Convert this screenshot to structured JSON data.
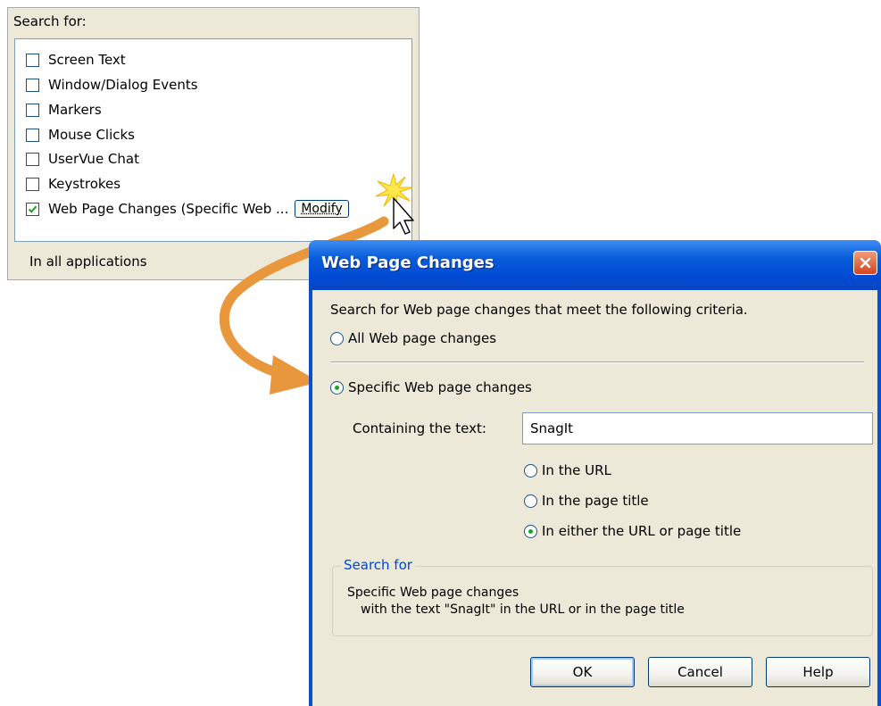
{
  "search_panel": {
    "heading": "Search for:",
    "options": [
      {
        "label": "Screen Text",
        "checked": false
      },
      {
        "label": "Window/Dialog Events",
        "checked": false
      },
      {
        "label": "Markers",
        "checked": false
      },
      {
        "label": "Mouse Clicks",
        "checked": false
      },
      {
        "label": "UserVue Chat",
        "checked": false
      },
      {
        "label": "Keystrokes",
        "checked": false
      },
      {
        "label": "Web Page Changes (Specific Web ...",
        "checked": true
      }
    ],
    "modify_label": "Modify",
    "scope_label": "In all applications"
  },
  "dialog": {
    "title": "Web Page Changes",
    "intro": "Search for Web page changes that meet the following criteria.",
    "mode_all_label": "All Web page changes",
    "mode_specific_label": "Specific Web page changes",
    "selected_mode": "specific",
    "containing_label": "Containing the text:",
    "containing_value": "SnagIt",
    "location_options": [
      {
        "label": "In the URL",
        "selected": false
      },
      {
        "label": "In the page title",
        "selected": false
      },
      {
        "label": "In either the URL or page title",
        "selected": true
      }
    ],
    "summary": {
      "legend": "Search for",
      "line1": "Specific Web page changes",
      "line2": "with the text \"SnagIt\" in the URL or in the page title"
    },
    "buttons": {
      "ok": "OK",
      "cancel": "Cancel",
      "help": "Help"
    }
  },
  "colors": {
    "title_bar": "#0a5ddb",
    "callout_arrow": "#e8973d",
    "legend_text": "#0046d5"
  }
}
